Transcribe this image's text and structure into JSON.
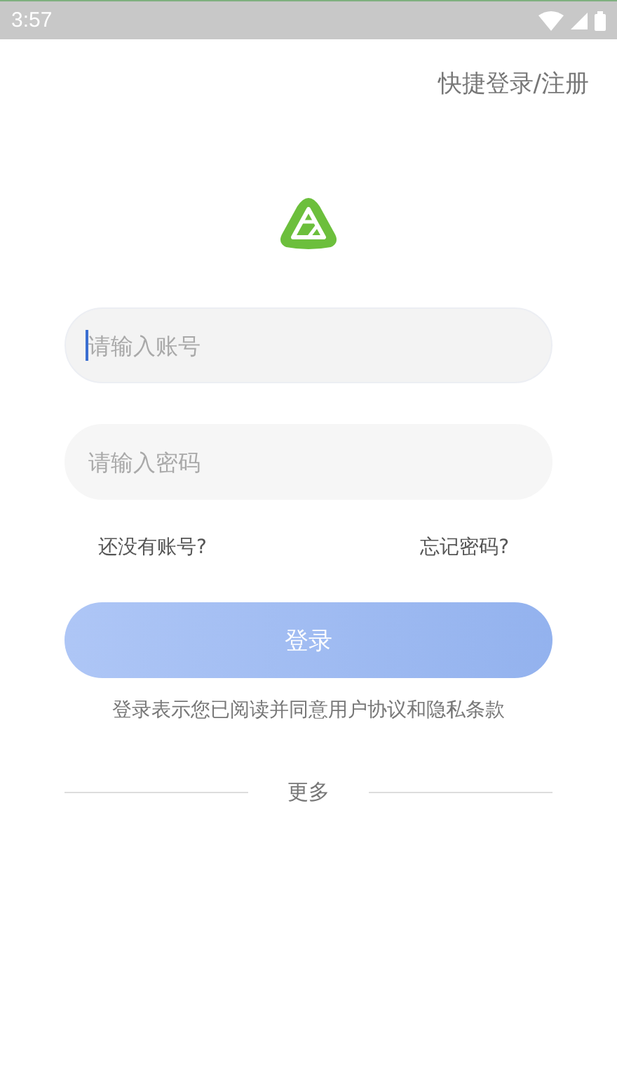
{
  "status_bar": {
    "time": "3:57"
  },
  "header": {
    "quick_login": "快捷登录/注册"
  },
  "fields": [
    {
      "placeholder": "请输入账号",
      "focused": true
    },
    {
      "placeholder": "请输入密码",
      "focused": false
    }
  ],
  "links": {
    "register": "还没有账号?",
    "forgot": "忘记密码?"
  },
  "login_button": "登录",
  "agreement": "登录表示您已阅读并同意用户协议和隐私条款",
  "more": "更多"
}
